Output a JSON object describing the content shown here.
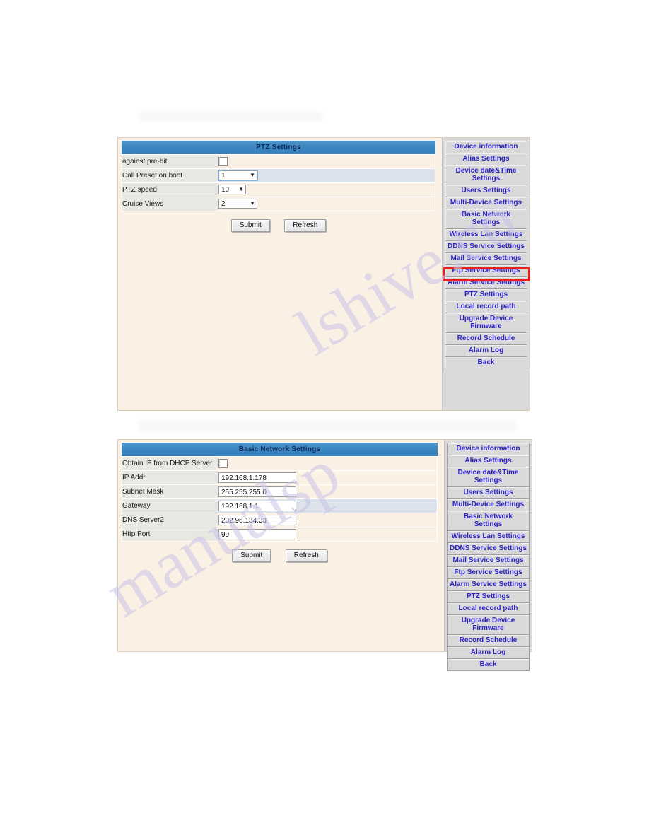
{
  "watermark": {
    "top_text": "lshive.co",
    "bottom_text": "manualsp"
  },
  "panel_ptz": {
    "form": {
      "title": "PTZ Settings",
      "rows": [
        {
          "label": "against pre-bit",
          "widget": "checkbox",
          "value": "",
          "checked": false
        },
        {
          "label": "Call Preset on boot",
          "widget": "select-wide-focused",
          "value": "1"
        },
        {
          "label": "PTZ speed",
          "widget": "select-narrow",
          "value": "10"
        },
        {
          "label": "Cruise Views",
          "widget": "select-wide",
          "value": "2"
        }
      ],
      "submit_label": "Submit",
      "refresh_label": "Refresh"
    },
    "nav": {
      "items": [
        {
          "label": "Device information",
          "lines": 1
        },
        {
          "label": "Alias Settings",
          "lines": 1
        },
        {
          "label": "Device date&Time Settings",
          "lines": 2
        },
        {
          "label": "Users Settings",
          "lines": 1
        },
        {
          "label": "Multi-Device Settings",
          "lines": 1
        },
        {
          "label": "Basic Network Settings",
          "lines": 1
        },
        {
          "label": "Wireless Lan Settings",
          "lines": 1
        },
        {
          "label": "DDNS Service Settings",
          "lines": 1
        },
        {
          "label": "Mail Service Settings",
          "lines": 1
        },
        {
          "label": "Ftp Service Settings",
          "lines": 1
        },
        {
          "label": "Alarm Service Settings",
          "lines": 1
        },
        {
          "label": "PTZ Settings",
          "lines": 1
        },
        {
          "label": "Local record path",
          "lines": 1
        },
        {
          "label": "Upgrade Device Firmware",
          "lines": 2
        },
        {
          "label": "Record Schedule",
          "lines": 1
        },
        {
          "label": "Alarm Log",
          "lines": 1
        },
        {
          "label": "Back",
          "lines": 1
        }
      ],
      "highlighted_item": "PTZ Settings",
      "highlight_color": "#ee1c1c"
    }
  },
  "panel_network": {
    "form": {
      "title": "Basic Network Settings",
      "rows": [
        {
          "label": "Obtain IP from DHCP Server",
          "widget": "checkbox",
          "value": "",
          "checked": false
        },
        {
          "label": "IP Addr",
          "widget": "text",
          "value": "192.168.1.178"
        },
        {
          "label": "Subnet Mask",
          "widget": "text",
          "value": "255.255.255.0"
        },
        {
          "label": "Gateway",
          "widget": "text",
          "value": "192.168.1.1",
          "focused": true
        },
        {
          "label": "DNS Server2",
          "widget": "text",
          "value": "202.96.134.33"
        },
        {
          "label": "Http Port",
          "widget": "text",
          "value": "99"
        }
      ],
      "submit_label": "Submit",
      "refresh_label": "Refresh"
    },
    "nav": {
      "items": [
        {
          "label": "Device information",
          "lines": 1
        },
        {
          "label": "Alias Settings",
          "lines": 1
        },
        {
          "label": "Device date&Time Settings",
          "lines": 2
        },
        {
          "label": "Users Settings",
          "lines": 1
        },
        {
          "label": "Multi-Device Settings",
          "lines": 1
        },
        {
          "label": "Basic Network Settings",
          "lines": 1
        },
        {
          "label": "Wireless Lan Settings",
          "lines": 1
        },
        {
          "label": "DDNS Service Settings",
          "lines": 1
        },
        {
          "label": "Mail Service Settings",
          "lines": 1
        },
        {
          "label": "Ftp Service Settings",
          "lines": 1
        },
        {
          "label": "Alarm Service Settings",
          "lines": 1
        },
        {
          "label": "PTZ Settings",
          "lines": 1
        },
        {
          "label": "Local record path",
          "lines": 1
        },
        {
          "label": "Upgrade Device Firmware",
          "lines": 2
        },
        {
          "label": "Record Schedule",
          "lines": 1
        },
        {
          "label": "Alarm Log",
          "lines": 1
        },
        {
          "label": "Back",
          "lines": 1
        }
      ],
      "highlighted_item": null
    }
  },
  "theme": {
    "title_bar_color": "#3a85c0",
    "panel_bg": "#fbf0e4",
    "label_bg": "#e9e7e2",
    "nav_bg": "#d9d9d9",
    "nav_link_color": "#2d22c8"
  }
}
